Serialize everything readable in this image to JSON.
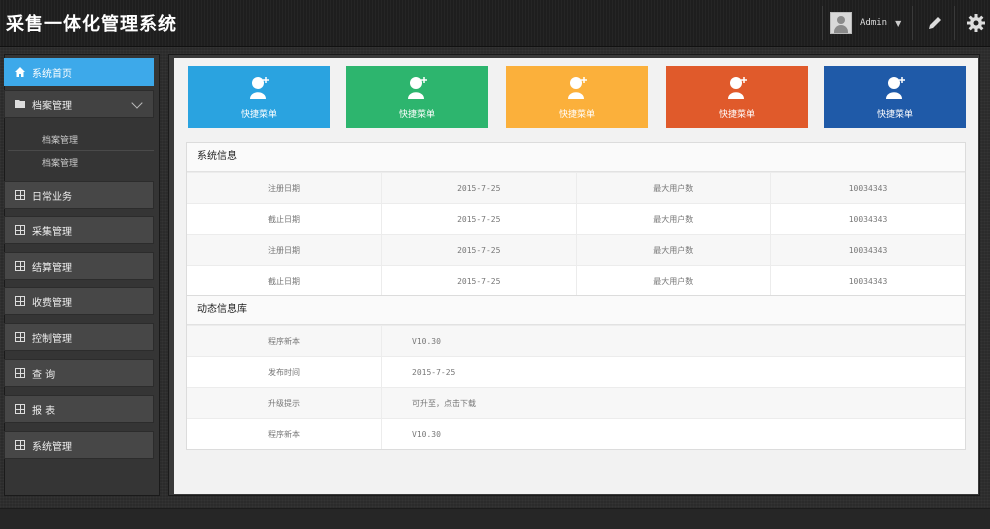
{
  "header": {
    "title": "采售一体化管理系统",
    "user": "Admin"
  },
  "sidebar": {
    "items": [
      {
        "label": "系统首页"
      },
      {
        "label": "档案管理"
      },
      {
        "label": "日常业务"
      },
      {
        "label": "采集管理"
      },
      {
        "label": "结算管理"
      },
      {
        "label": "收费管理"
      },
      {
        "label": "控制管理"
      },
      {
        "label": "查 询"
      },
      {
        "label": "报 表"
      },
      {
        "label": "系统管理"
      }
    ],
    "sub_items": [
      {
        "label": "档案管理"
      },
      {
        "label": "档案管理"
      }
    ]
  },
  "tiles": [
    {
      "label": "快捷菜单",
      "color": "#2aa3e0"
    },
    {
      "label": "快捷菜单",
      "color": "#2db56e"
    },
    {
      "label": "快捷菜单",
      "color": "#fbb03b"
    },
    {
      "label": "快捷菜单",
      "color": "#e05a2b"
    },
    {
      "label": "快捷菜单",
      "color": "#1f5aa8"
    }
  ],
  "system_info": {
    "title": "系统信息",
    "rows": [
      [
        "注册日期",
        "2015-7-25",
        "最大用户数",
        "10034343"
      ],
      [
        "截止日期",
        "2015-7-25",
        "最大用户数",
        "10034343"
      ],
      [
        "注册日期",
        "2015-7-25",
        "最大用户数",
        "10034343"
      ],
      [
        "截止日期",
        "2015-7-25",
        "最大用户数",
        "10034343"
      ]
    ]
  },
  "dynamic_info": {
    "title": "动态信息库",
    "rows": [
      [
        "程序新本",
        "V10.30"
      ],
      [
        "发布时间",
        "2015-7-25"
      ],
      [
        "升级提示",
        "可升至，点击下载"
      ],
      [
        "程序新本",
        "V10.30"
      ]
    ]
  },
  "colors": {
    "accent": "#3da9ea"
  }
}
